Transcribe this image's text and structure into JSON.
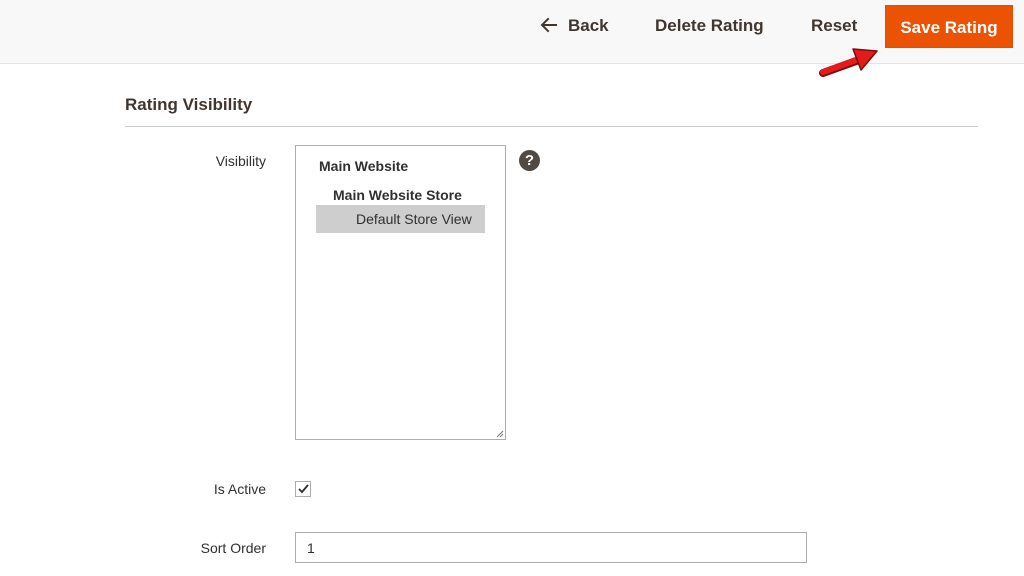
{
  "toolbar": {
    "back_label": "Back",
    "delete_label": "Delete Rating",
    "reset_label": "Reset",
    "save_label": "Save Rating",
    "accent_color": "#eb5202"
  },
  "section": {
    "title": "Rating Visibility"
  },
  "visibility": {
    "label": "Visibility",
    "website": "Main Website",
    "store": "Main Website Store",
    "store_view": "Default Store View",
    "selected": "Default Store View"
  },
  "is_active": {
    "label": "Is Active",
    "checked": true
  },
  "sort_order": {
    "label": "Sort Order",
    "value": "1"
  },
  "icons": {
    "back": "arrow-left-icon",
    "help": "question-mark-icon",
    "check": "checkmark-icon",
    "annotation": "red-pointer-arrow"
  }
}
